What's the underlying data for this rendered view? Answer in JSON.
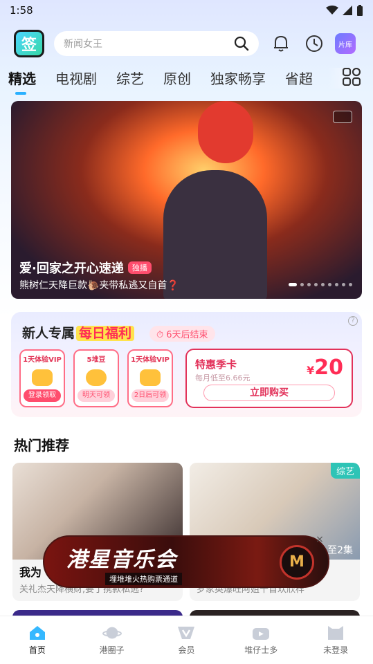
{
  "status": {
    "time": "1:58"
  },
  "header": {
    "logo_text": "签",
    "search_placeholder": "新闻女王",
    "library_label": "片库"
  },
  "tabs": [
    {
      "label": "精选",
      "active": true
    },
    {
      "label": "电视剧"
    },
    {
      "label": "综艺"
    },
    {
      "label": "原创"
    },
    {
      "label": "独家畅享"
    },
    {
      "label": "省超"
    }
  ],
  "banner": {
    "title": "爱·回家之开心速递",
    "badge": "独播",
    "subtitle": "熊树仁天降巨款🐌夹带私逃又自首❓",
    "total_slides": 9,
    "active_slide": 1
  },
  "welfare": {
    "title_prefix": "新人专属",
    "title_highlight": "每日福利",
    "countdown": "6天后结束",
    "cards": [
      {
        "title": "1天体验VIP",
        "button": "登录领取",
        "enabled": true
      },
      {
        "title": "5堆豆",
        "button": "明天可领",
        "enabled": false
      },
      {
        "title": "1天体验VIP",
        "button": "2日后可领",
        "enabled": false
      }
    ],
    "season": {
      "title": "特惠季卡",
      "subtitle": "每月低至6.66元",
      "price_symbol": "¥",
      "price": "20",
      "button": "立即购买"
    }
  },
  "hot": {
    "title": "热门推荐",
    "cards": [
      {
        "title": "我为",
        "subtitle": "关礼杰天降横财,要了携款私逃?"
      },
      {
        "title": "",
        "subtitle": "罗家英爆旺阿姐千首欢欣样",
        "tag": "综艺",
        "episodes": "至2集"
      }
    ]
  },
  "ad": {
    "title": "港星音乐会",
    "subtitle": "埋堆堆火热购票通道",
    "close": "×"
  },
  "tabbar": [
    {
      "label": "首页",
      "icon": "home-icon",
      "active": true
    },
    {
      "label": "港圈子",
      "icon": "planet-icon"
    },
    {
      "label": "会员",
      "icon": "vip-icon"
    },
    {
      "label": "堆仔士多",
      "icon": "store-icon"
    },
    {
      "label": "未登录",
      "icon": "profile-icon"
    }
  ],
  "colors": {
    "accent": "#2ab0ff",
    "promo": "#ff2d55",
    "tag": "#2ec4b6"
  }
}
